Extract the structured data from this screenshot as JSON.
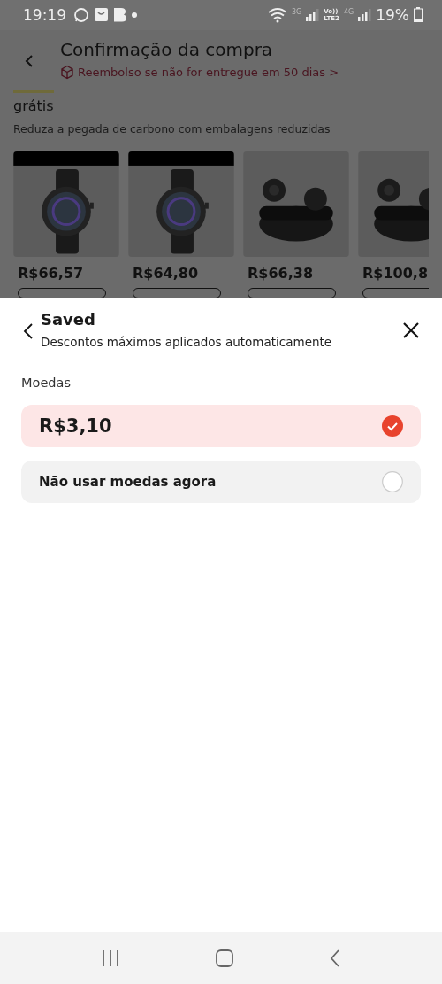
{
  "status_bar": {
    "time": "19:19",
    "network_1": "3G",
    "volte_top": "Vo))",
    "volte_bottom": "LTE2",
    "network_2": "4G",
    "battery": "19%"
  },
  "header": {
    "title": "Confirmação da compra",
    "subtitle": "Reembolso se não for entregue em 50 dias >"
  },
  "section": {
    "title": "grátis",
    "description": "Reduza a pegada de carbono com embalagens reduzidas"
  },
  "products": [
    {
      "kind": "picture",
      "price": "R$66,57"
    },
    {
      "kind": "picture",
      "price": "R$64,80"
    },
    {
      "kind": "picture",
      "price": "R$66,38"
    },
    {
      "kind": "picture",
      "price": "R$100,8"
    }
  ],
  "sheet": {
    "title": "Saved",
    "subtitle": "Descontos máximos aplicados automaticamente",
    "section_label": "Moedas",
    "options": [
      {
        "kind": "amount",
        "label": "R$3,10",
        "selected": true
      },
      {
        "kind": "text",
        "label": "Não usar moedas agora",
        "selected": false
      }
    ]
  }
}
